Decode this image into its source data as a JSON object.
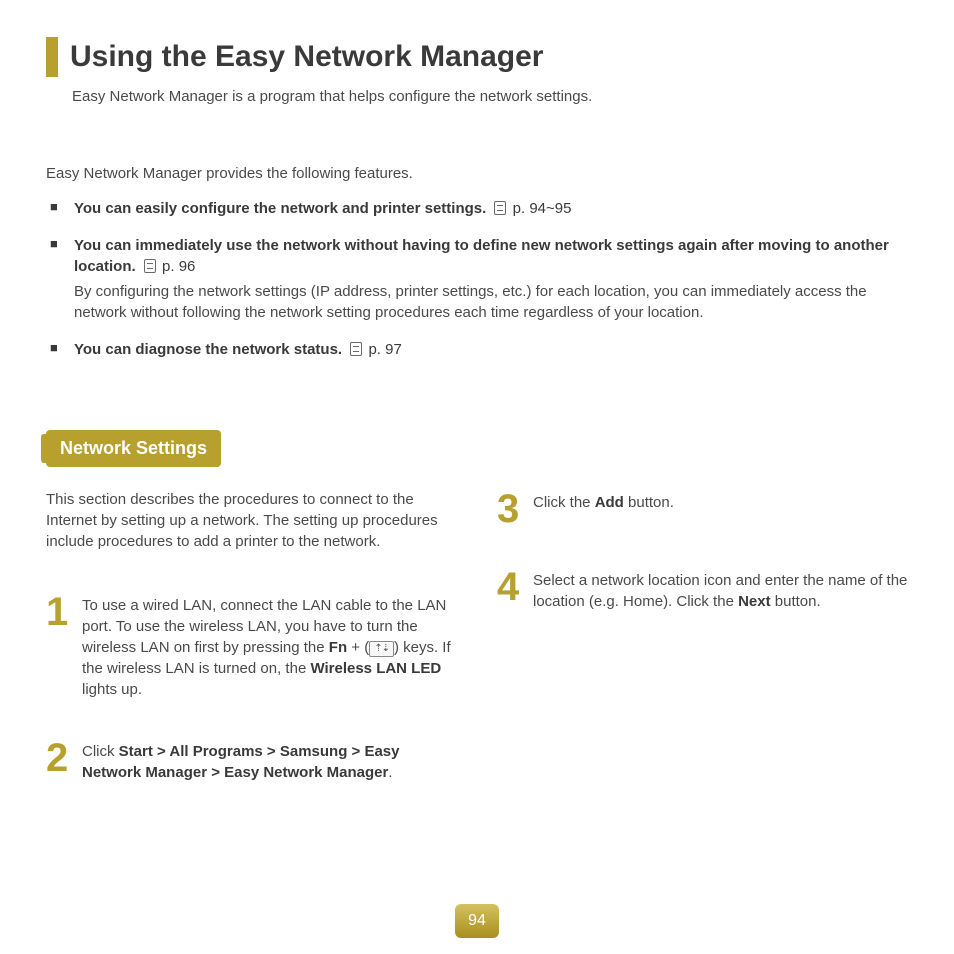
{
  "title": "Using the Easy Network Manager",
  "subtitle": "Easy Network Manager is a program that helps configure the network settings.",
  "intro": "Easy Network Manager provides the following features.",
  "features": [
    {
      "main": "You can easily configure the network and printer settings.",
      "pageref": "p. 94~95",
      "desc": ""
    },
    {
      "main": "You can immediately use the network without having to define new network settings again after moving to another location.",
      "pageref": "p. 96",
      "desc": "By configuring the network settings (IP address, printer settings, etc.) for each location, you can immediately access the network without following the network setting procedures each time regardless of your location."
    },
    {
      "main": "You can diagnose the network status.",
      "pageref": "p. 97",
      "desc": ""
    }
  ],
  "section": {
    "badge": "Network Settings",
    "intro": "This section describes the procedures to connect to the Internet by setting up a network. The setting up procedures include procedures to add a printer to the network.",
    "steps": {
      "s1": {
        "a": "To use a wired LAN, connect the LAN cable to the LAN port. To use the wireless LAN, you have to turn the wireless LAN on first by pressing the  ",
        "fn": "Fn",
        "b": " + (",
        "key": "⇡⇣",
        "c": ") keys. If the wireless LAN is turned on, the ",
        "led": "Wireless LAN LED",
        "d": " lights up."
      },
      "s2": {
        "a": "Click ",
        "path": "Start > All Programs > Samsung > Easy Network Manager > Easy Network Manager",
        "b": "."
      },
      "s3": {
        "a": "Click the ",
        "add": "Add",
        "b": " button."
      },
      "s4": {
        "a": "Select a network location icon and enter the name of the location (e.g. Home). Click the ",
        "next": "Next",
        "b": " button."
      }
    }
  },
  "pageNumber": "94"
}
